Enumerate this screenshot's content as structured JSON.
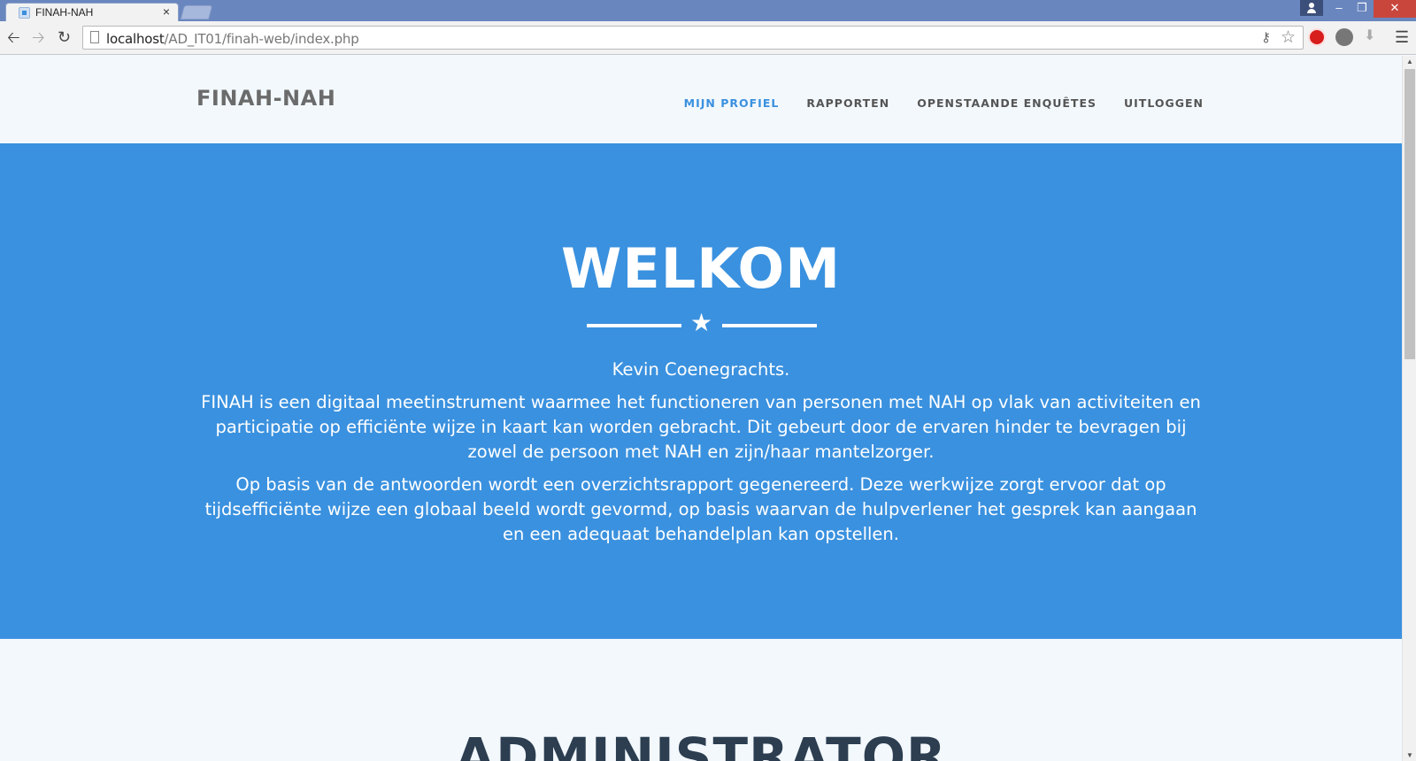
{
  "browser": {
    "tab_title": "FINAH-NAH",
    "tab_close": "×",
    "url_host": "localhost",
    "url_path": "/AD_IT01/finah-web/index.php",
    "window_min": "–",
    "window_max": "❐",
    "window_close": "✕"
  },
  "navbar": {
    "brand": "FINAH-NAH",
    "links": [
      {
        "label": "MIJN PROFIEL",
        "active": true
      },
      {
        "label": "RAPPORTEN",
        "active": false
      },
      {
        "label": "OPENSTAANDE ENQUÊTES",
        "active": false
      },
      {
        "label": "UITLOGGEN",
        "active": false
      }
    ],
    "active_color": "#3a91df"
  },
  "hero": {
    "title": "WELKOM",
    "name": "Kevin Coenegrachts.",
    "paragraph1": "FINAH is een digitaal meetinstrument waarmee het functioneren van personen met NAH op vlak van activiteiten en participatie op efficiënte wijze in kaart kan worden gebracht. Dit gebeurt door de ervaren hinder te bevragen bij zowel de persoon met NAH en zijn/haar mantelzorger.",
    "paragraph2": "Op basis van de antwoorden wordt een overzichtsrapport gegenereerd. Deze werkwijze zorgt ervoor dat op tijdsefficiënte wijze een globaal beeld wordt gevormd, op basis waarvan de hulpverlener het gesprek kan aangaan en een adequaat behandelplan kan opstellen.",
    "background_color": "#3a91df"
  },
  "section": {
    "title": "ADMINISTRATOR"
  }
}
